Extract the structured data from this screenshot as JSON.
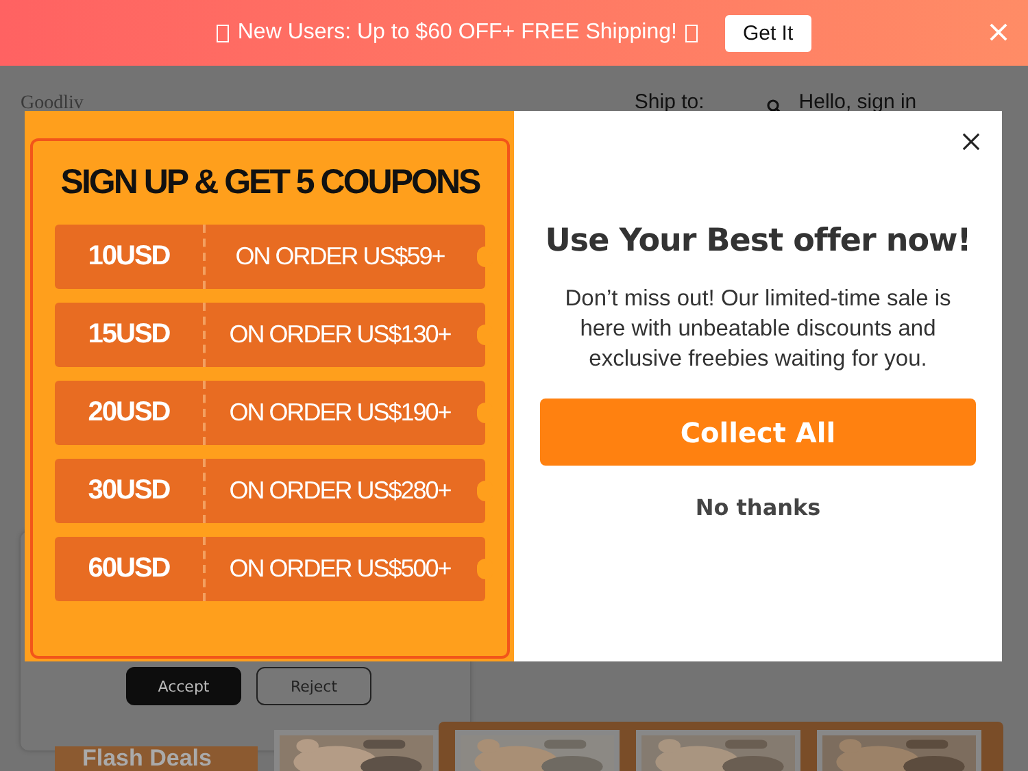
{
  "banner": {
    "text": "New Users: Up to $60 OFF+ FREE Shipping!",
    "button": "Get It"
  },
  "header": {
    "logo": "Goodliv",
    "ship_to": "Ship to:",
    "greeting": "Hello, sign in"
  },
  "cookie_banner": {
    "buttons": [
      {
        "label": "Accept",
        "kind": "primary"
      },
      {
        "label": "Reject",
        "kind": "outline"
      }
    ]
  },
  "flash_deals": {
    "title": "Flash Deals"
  },
  "modal": {
    "promo_title": "SIGN UP & GET 5 COUPONS",
    "coupons": [
      {
        "amount": "10USD",
        "condition": "ON ORDER US$59+"
      },
      {
        "amount": "15USD",
        "condition": "ON ORDER US$130+"
      },
      {
        "amount": "20USD",
        "condition": "ON ORDER US$190+"
      },
      {
        "amount": "30USD",
        "condition": "ON ORDER US$280+"
      },
      {
        "amount": "60USD",
        "condition": "ON ORDER US$500+"
      }
    ],
    "heading": "Use Your Best offer now!",
    "body": "Don’t miss out! Our limited-time sale is here with unbeatable discounts and exclusive freebies waiting for you.",
    "primary_button": "Collect All",
    "secondary_button": "No thanks"
  }
}
